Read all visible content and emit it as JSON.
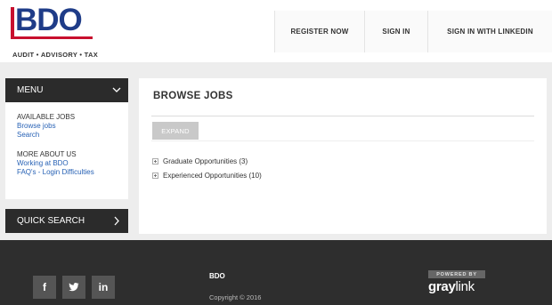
{
  "brand": {
    "logo_text": "BDO",
    "tagline": "AUDIT • ADVISORY • TAX",
    "accent_red": "#c8102e",
    "accent_blue": "#1f3c88"
  },
  "topnav": {
    "register": "REGISTER NOW",
    "signin": "SIGN IN",
    "linkedin": "SIGN IN WITH LINKEDIN"
  },
  "sidebar": {
    "menu_label": "MENU",
    "sections": [
      {
        "title": "AVAILABLE JOBS",
        "links": [
          "Browse jobs",
          "Search"
        ]
      },
      {
        "title": "MORE ABOUT US",
        "links": [
          "Working at BDO",
          "FAQ's - Login Difficulties"
        ]
      }
    ],
    "quick_search": "QUICK SEARCH"
  },
  "main": {
    "title": "BROWSE JOBS",
    "expand": "EXPAND",
    "categories": [
      "Graduate Opportunities (3)",
      "Experienced Opportunities (10)"
    ]
  },
  "footer": {
    "brand": "BDO",
    "copyright": "Copyright © 2016",
    "social": [
      "f",
      "t",
      "in"
    ],
    "powered_by": "POWERED BY",
    "graylink_bold": "gray",
    "graylink_thin": "link"
  }
}
